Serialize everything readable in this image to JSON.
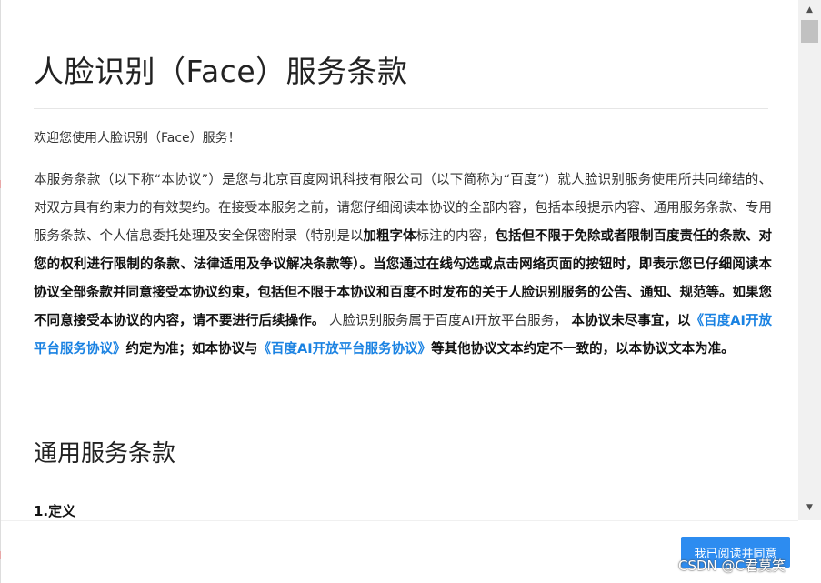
{
  "modal": {
    "title": "人脸识别（Face）服务条款",
    "welcome": "欢迎您使用人脸识别（Face）服务！",
    "intro": {
      "t1": "本服务条款（以下称“本协议”）是您与北京百度网讯科技有限公司（以下简称为“百度”）就人脸识别服务使用所共同缔结的、对双方具有约束力的有效契约。在接受本服务之前，请您仔细阅读本协议的全部内容，包括本段提示内容、通用服务条款、专用服务条款、个人信息委托处理及安全保密附录（特别是以",
      "t2": "加粗字体",
      "t3": "标注的内容，",
      "t4": "包括但不限于免除或者限制百度责任的条款、对您的权利进行限制的条款、法律适用及争议解决条款等）。当您通过在线勾选或点击网络页面的按钮时，即表示您已仔细阅读本协议全部条款并同意接受本协议约束，包括但不限于本协议和百度不时发布的关于人脸识别服务的公告、通知、规范等。如果您不同意接受本协议的内容，请不要进行后续操作。",
      "t5": "人脸识别服务属于百度AI开放平台服务，",
      "t6": "本协议未尽事宜，以",
      "link1": "《百度AI开放平台服务协议》",
      "t7": "约定为准；如本协议与",
      "link2": "《百度AI开放平台服务协议》",
      "t8": "等其他协议文本约定不一致的，以本协议文本为准。"
    },
    "section_title": "通用服务条款",
    "subsection": "1.定义",
    "agree_label": "我已阅读并同意"
  },
  "scrollbar": {
    "up_icon": "triangle-up",
    "down_icon": "triangle-down"
  },
  "watermark": "CSDN @C君莫笑",
  "colors": {
    "link": "#1a82e2",
    "button": "#2d8cf0"
  }
}
